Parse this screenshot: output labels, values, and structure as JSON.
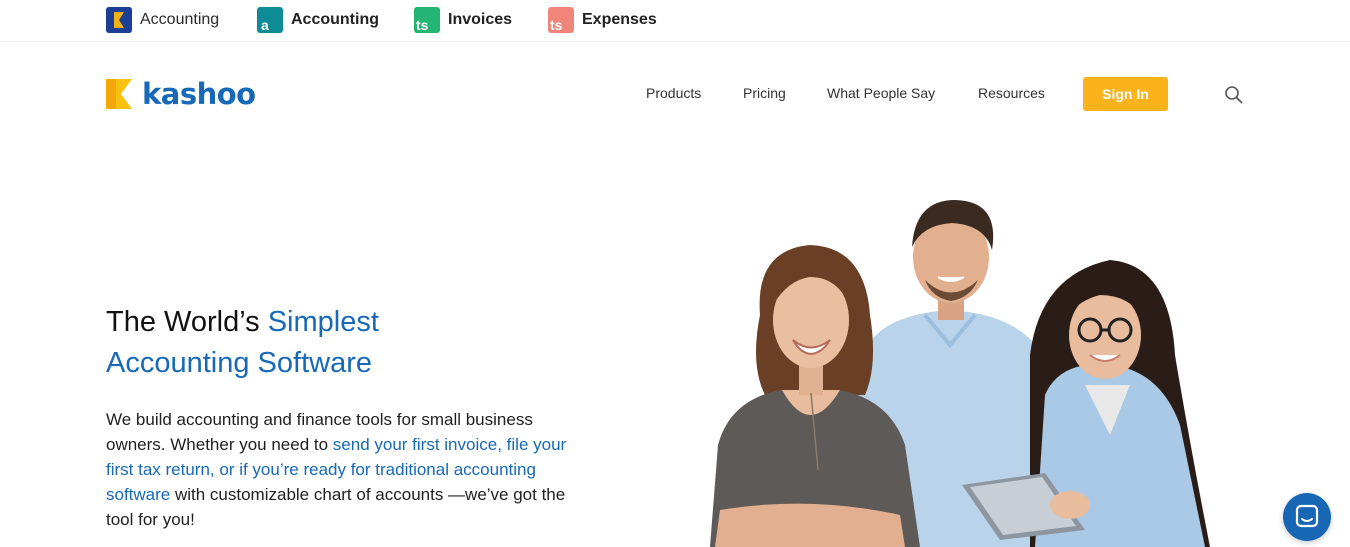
{
  "topbar": {
    "products": [
      {
        "label": "Accounting",
        "icon": "kashoo-k-logo-icon",
        "color": "#1c3f94",
        "accent": "#f5b31a"
      },
      {
        "label": "Accounting",
        "icon": "a-letter-logo-icon",
        "color": "#0e8c96",
        "glyph": "a"
      },
      {
        "label": "Invoices",
        "icon": "ts-invoices-logo-icon",
        "color": "#22b573",
        "glyph": "ts"
      },
      {
        "label": "Expenses",
        "icon": "ts-expenses-logo-icon",
        "color": "#f2857a",
        "glyph": "ts"
      }
    ]
  },
  "header": {
    "brand": "kashoo",
    "brand_color": "#1769b8",
    "logo_accent": "#fac20f",
    "nav": [
      "Products",
      "Pricing",
      "What People Say",
      "Resources"
    ],
    "signin_label": "Sign In",
    "signin_color": "#fab31b",
    "search_icon": "search-icon"
  },
  "hero": {
    "title_plain": "The World’s ",
    "title_blue_1": "Simplest",
    "title_blue_2": "Accounting Software",
    "body_1": "We build accounting and finance tools for small business owners. Whether you need to ",
    "link_1": "send your first invoice,",
    "body_2": " ",
    "link_2": "file your first tax return,",
    "body_3": " ",
    "link_3": "or if you’re ready for traditional accounting software",
    "body_4": " with customizable chart of accounts —we’ve got the tool for you!"
  },
  "chat": {
    "icon": "chat-bubble-icon",
    "color": "#1767b4"
  }
}
